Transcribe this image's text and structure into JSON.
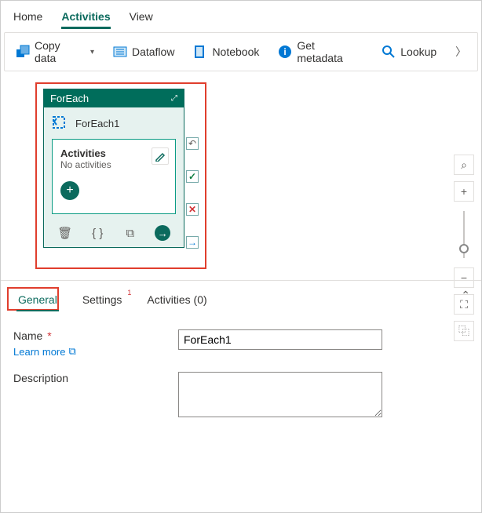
{
  "top_tabs": {
    "home": "Home",
    "activities": "Activities",
    "view": "View"
  },
  "toolbar": {
    "copy_data": "Copy data",
    "dataflow": "Dataflow",
    "notebook": "Notebook",
    "get_metadata": "Get metadata",
    "lookup": "Lookup"
  },
  "activity": {
    "type_label": "ForEach",
    "name": "ForEach1",
    "inner_title": "Activities",
    "inner_subtitle": "No activities"
  },
  "zoom": {
    "search_icon": "⌕",
    "plus": "+",
    "minus": "−",
    "fit": "⛶",
    "layout": "⿻"
  },
  "handles": {
    "undo": "↶",
    "check": "✓",
    "x": "✕",
    "arrow": "→"
  },
  "footer_icons": {
    "trash": "🗑",
    "braces": "{ }",
    "copy": "⧉",
    "go": "→"
  },
  "prop_tabs": {
    "general": "General",
    "settings": "Settings",
    "settings_badge": "1",
    "activities": "Activities (0)"
  },
  "form": {
    "name_label": "Name",
    "name_value": "ForEach1",
    "learn_more": "Learn more",
    "learn_more_icon": "⧉",
    "description_label": "Description",
    "description_value": ""
  },
  "collapse_icon": "⌃"
}
